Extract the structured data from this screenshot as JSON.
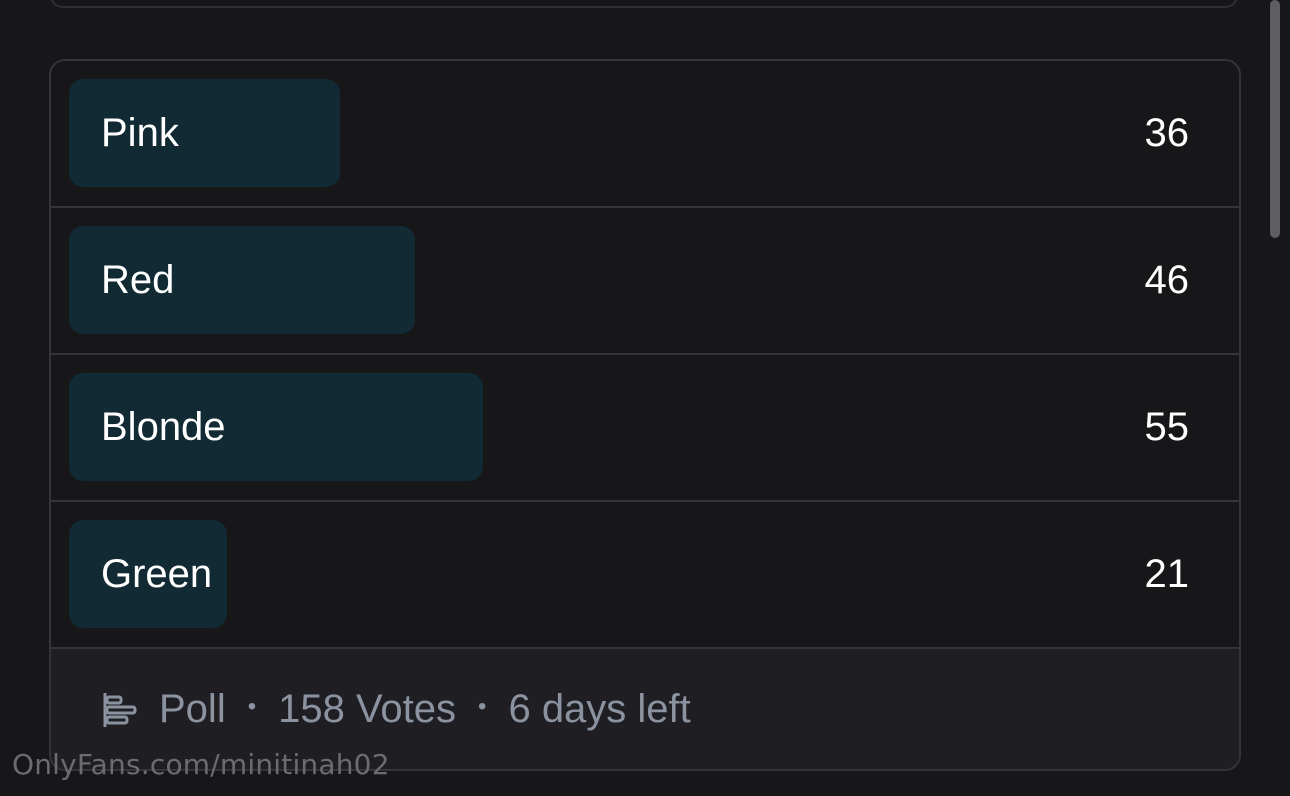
{
  "poll": {
    "options": [
      {
        "label": "Pink",
        "count": "36",
        "votes": 36
      },
      {
        "label": "Red",
        "count": "46",
        "votes": 46
      },
      {
        "label": "Blonde",
        "count": "55",
        "votes": 55
      },
      {
        "label": "Green",
        "count": "21",
        "votes": 21
      }
    ],
    "footer": {
      "type": "Poll",
      "votes": "158 Votes",
      "time_left": "6 days left",
      "separator": "•"
    }
  },
  "watermark": "OnlyFans.com/minitinah02",
  "colors": {
    "background": "#171618",
    "bar": "#122a33",
    "border": "#34353a",
    "footer_text": "#8b93a1"
  },
  "icons": {
    "poll_icon": "poll-bars-icon"
  }
}
